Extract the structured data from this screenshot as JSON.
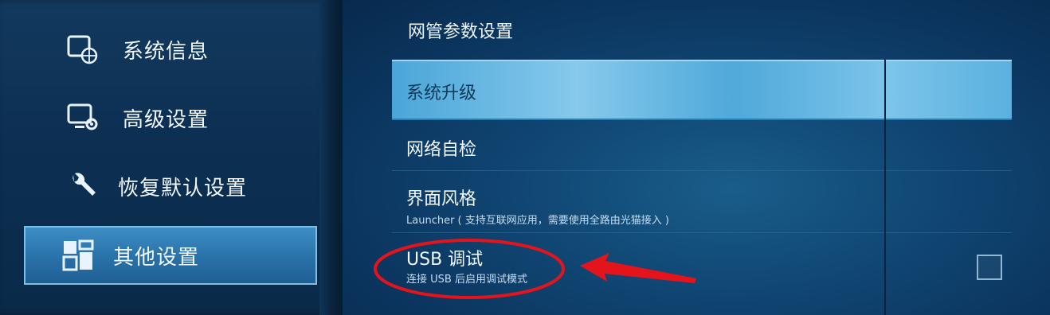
{
  "sidebar": {
    "items": [
      {
        "label": "系统信息",
        "icon": "system-info-icon"
      },
      {
        "label": "高级设置",
        "icon": "advanced-settings-icon"
      },
      {
        "label": "恢复默认设置",
        "icon": "wrench-icon"
      },
      {
        "label": "其他设置",
        "icon": "tiles-icon",
        "selected": true
      }
    ]
  },
  "content": {
    "section_title": "网管参数设置",
    "rows": [
      {
        "label": "系统升级",
        "highlighted": true
      },
      {
        "label": "网络自检"
      },
      {
        "label": "界面风格",
        "sub": "Launcher ( 支持互联网应用，需要使用全路由光猫接入 )"
      },
      {
        "label": "USB 调试",
        "sub": "连接 USB 后启用调试模式",
        "checkbox_checked": false
      }
    ]
  },
  "annotation": {
    "color": "#e3141b"
  }
}
